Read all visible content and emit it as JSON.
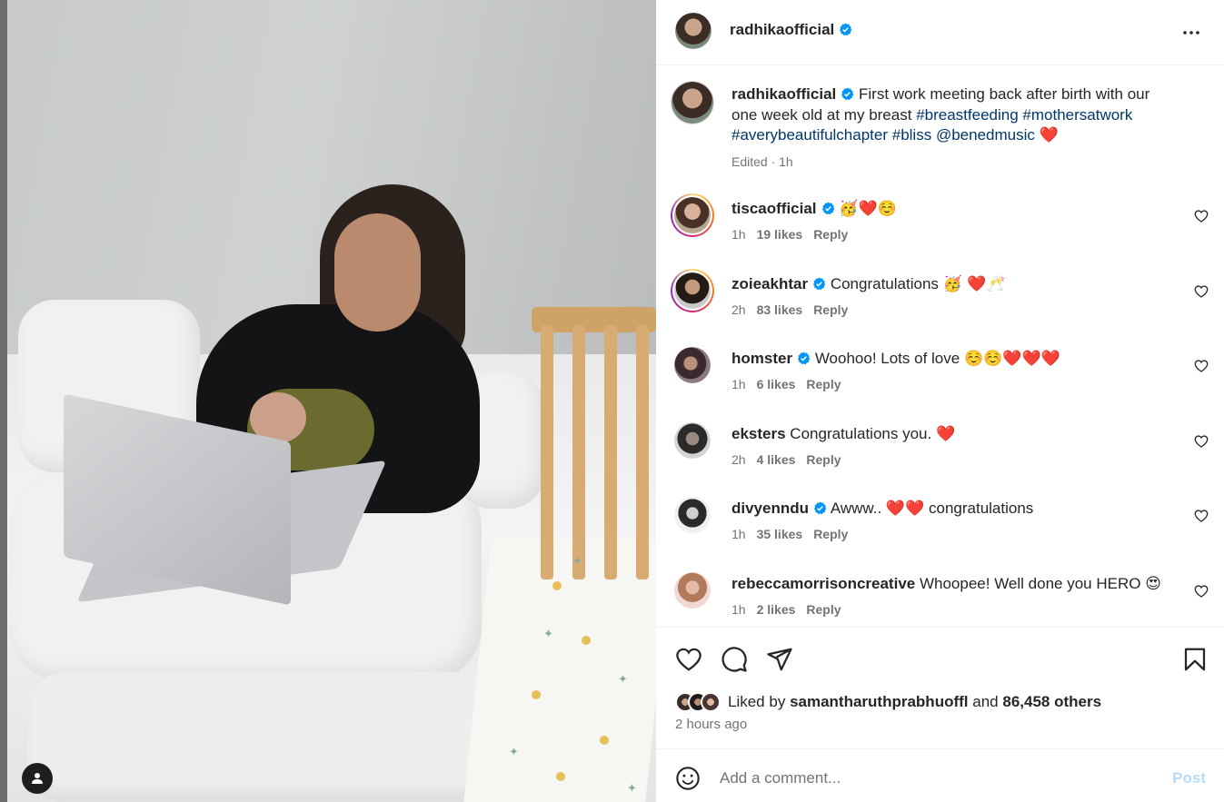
{
  "post": {
    "author": "radhikaofficial",
    "caption_text": "First work meeting back after birth with our one week old at my breast",
    "hashtags": [
      "#breastfeeding",
      "#mothersatwork",
      "#averybeautifulchapter",
      "#bliss"
    ],
    "mention": "@benedmusic",
    "caption_emoji": "❤️",
    "edited": "Edited · 1h"
  },
  "comments": [
    {
      "user": "tiscaofficial",
      "verified": true,
      "text": "",
      "emoji": "🥳❤️☺️",
      "time": "1h",
      "likes": "19 likes",
      "reply": "Reply",
      "ring": true
    },
    {
      "user": "zoieakhtar",
      "verified": true,
      "text": "Congratulations",
      "emoji": "🥳 ❤️🥂",
      "time": "2h",
      "likes": "83 likes",
      "reply": "Reply",
      "ring": true
    },
    {
      "user": "homster",
      "verified": true,
      "text": "Woohoo! Lots of love",
      "emoji": "☺️☺️❤️❤️❤️",
      "time": "1h",
      "likes": "6 likes",
      "reply": "Reply",
      "ring": false
    },
    {
      "user": "eksters",
      "verified": false,
      "text": "Congratulations you.",
      "emoji": "❤️",
      "time": "2h",
      "likes": "4 likes",
      "reply": "Reply",
      "ring": false
    },
    {
      "user": "divyenndu",
      "verified": true,
      "text": "Awww..",
      "emoji": "❤️❤️",
      "text_after": "congratulations",
      "time": "1h",
      "likes": "35 likes",
      "reply": "Reply",
      "ring": false
    },
    {
      "user": "rebeccamorrisoncreative",
      "verified": false,
      "text": "Whoopee! Well done you HERO",
      "emoji": "😍",
      "time": "1h",
      "likes": "2 likes",
      "reply": "Reply",
      "ring": false
    }
  ],
  "likes": {
    "prefix": "Liked by",
    "user": "samantharuthprabhuoffl",
    "and": "and",
    "others": "86,458 others"
  },
  "timestamp": "2 hours ago",
  "add_comment": {
    "placeholder": "Add a comment...",
    "post_label": "Post"
  },
  "colors": {
    "verified": "#0095f6",
    "link": "#00376b",
    "post_disabled": "#b6dcfa"
  },
  "icons": [
    "more-options-icon",
    "verified-badge-icon",
    "heart-icon",
    "comment-icon",
    "share-icon",
    "bookmark-icon",
    "emoji-icon",
    "user-icon"
  ]
}
